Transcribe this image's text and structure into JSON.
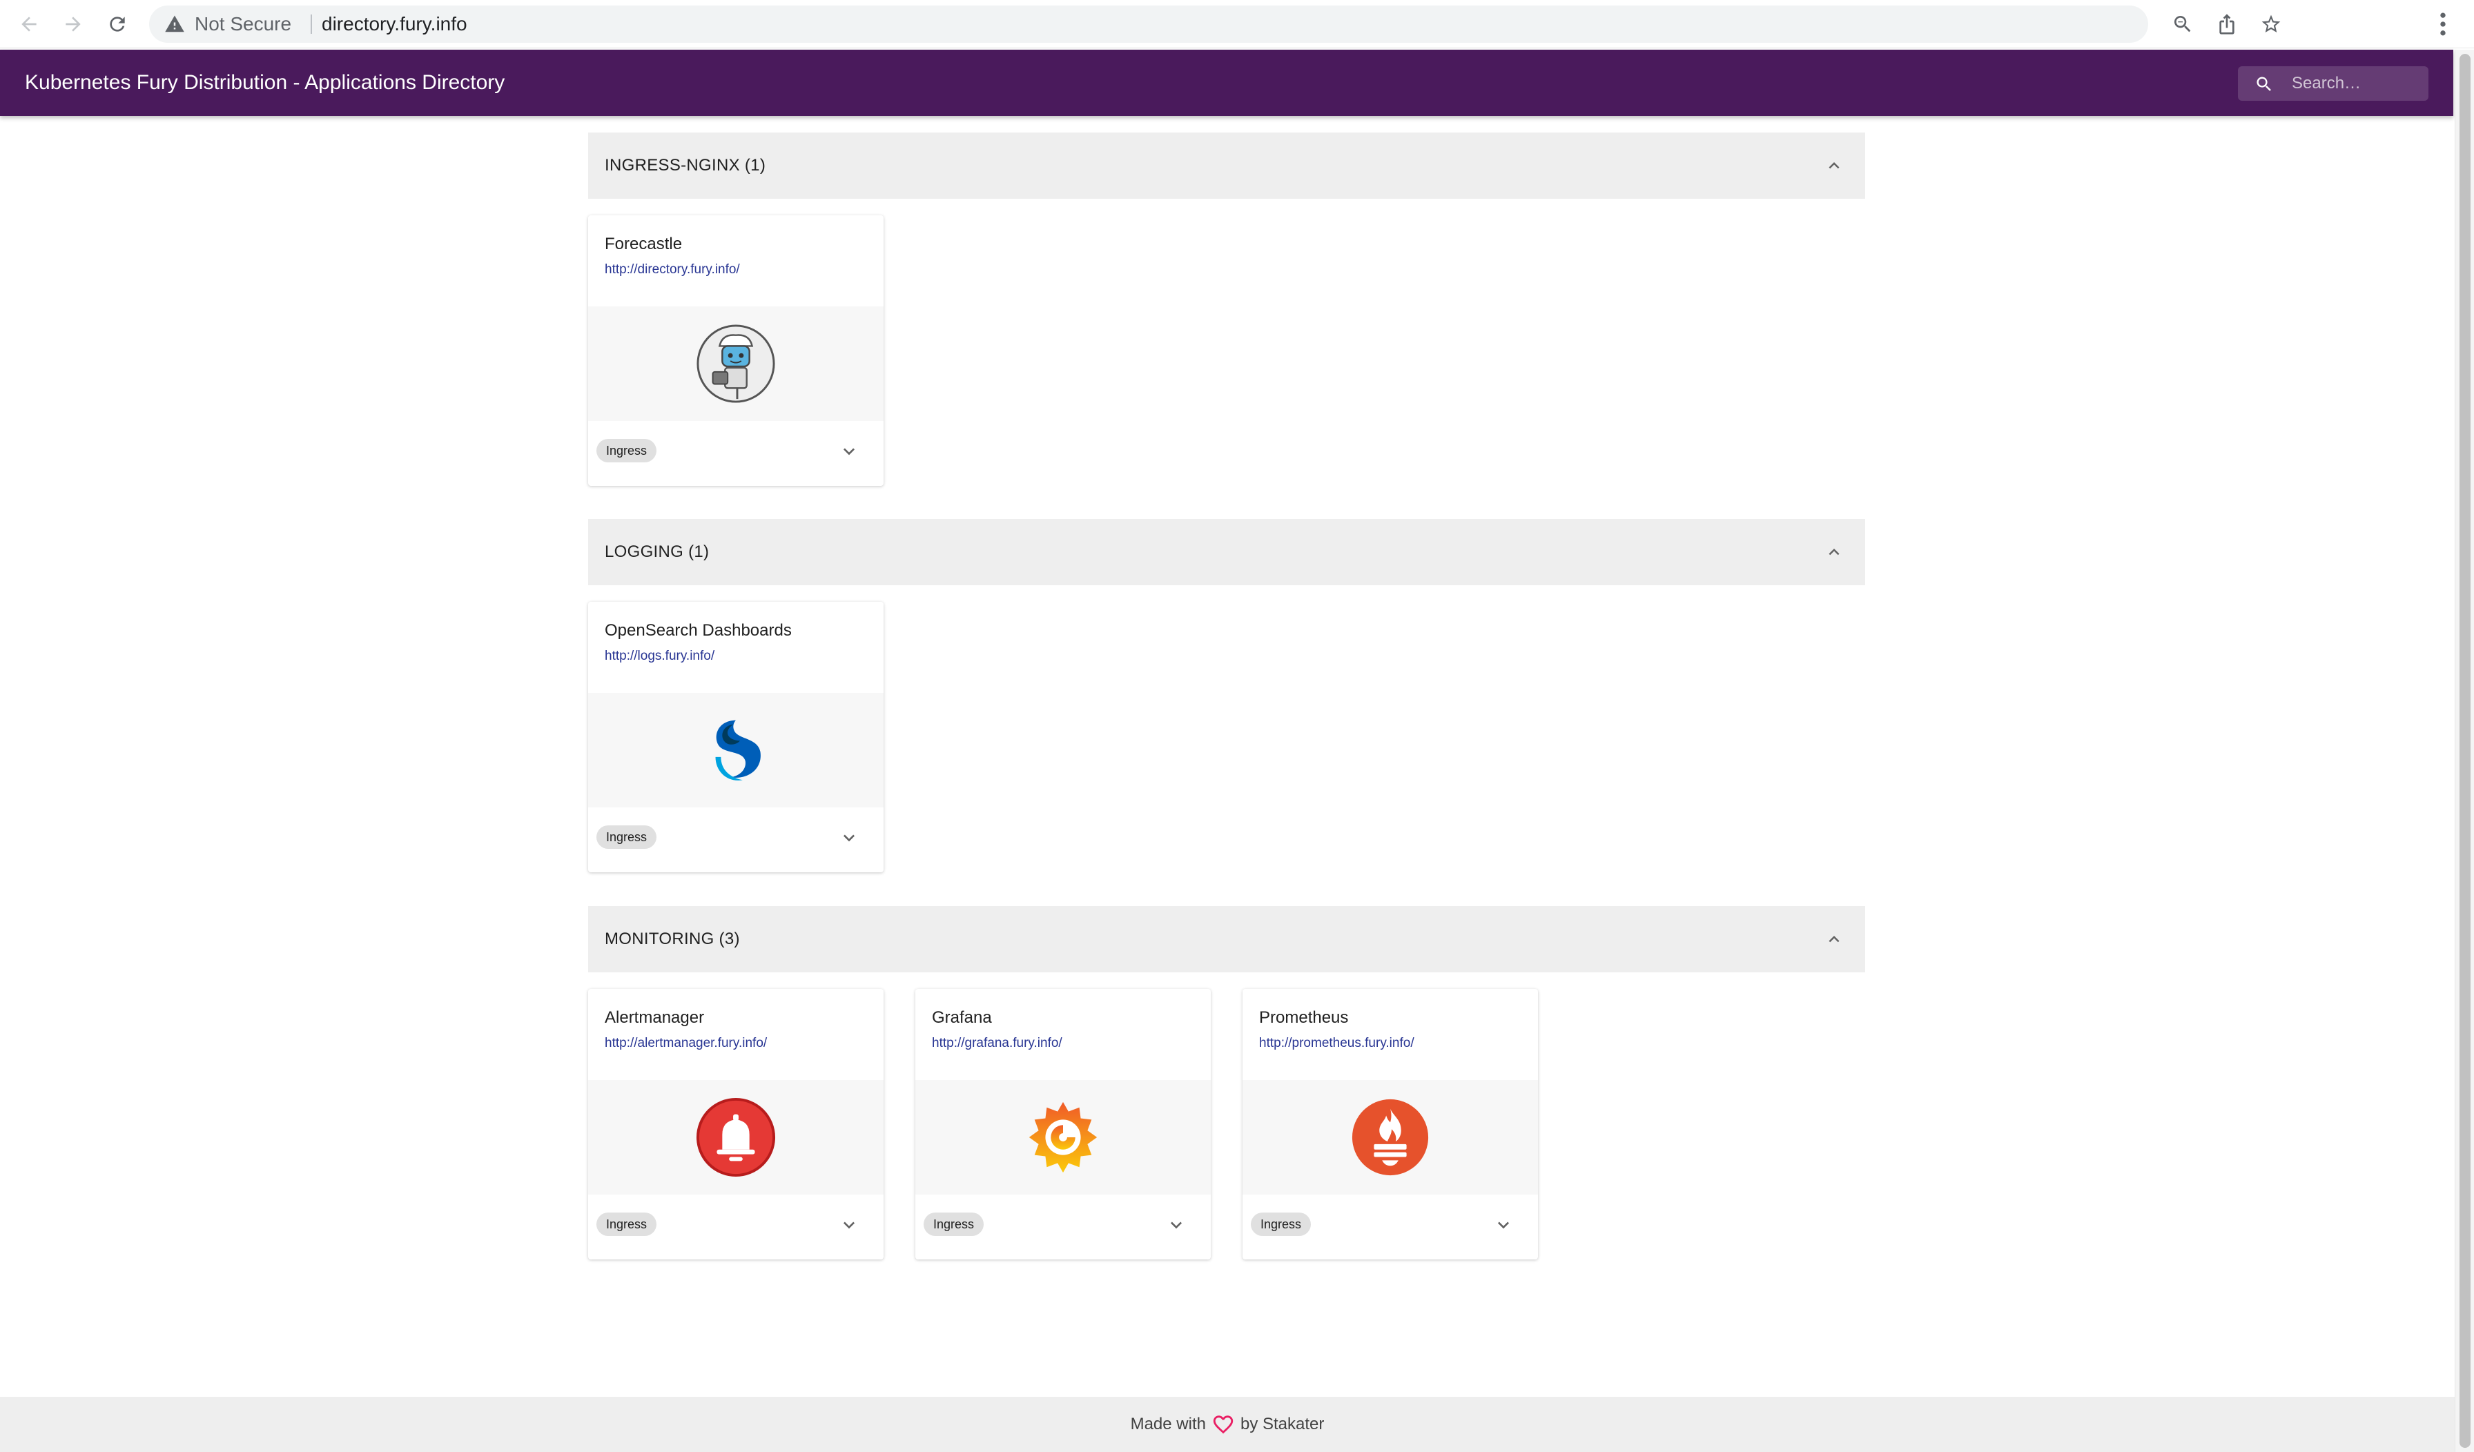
{
  "browser": {
    "security_label": "Not Secure",
    "url": "directory.fury.info"
  },
  "header": {
    "title": "Kubernetes Fury Distribution - Applications Directory",
    "search_placeholder": "Search…",
    "background_color": "#4a1a5c"
  },
  "sections": [
    {
      "title": "INGRESS-NGINX (1)",
      "apps": [
        {
          "name": "Forecastle",
          "url": "http://directory.fury.info/",
          "icon": "forecastle-logo-icon",
          "tag": "Ingress"
        }
      ]
    },
    {
      "title": "LOGGING (1)",
      "apps": [
        {
          "name": "OpenSearch Dashboards",
          "url": "http://logs.fury.info/",
          "icon": "opensearch-logo-icon",
          "tag": "Ingress"
        }
      ]
    },
    {
      "title": "MONITORING (3)",
      "apps": [
        {
          "name": "Alertmanager",
          "url": "http://alertmanager.fury.info/",
          "icon": "alertmanager-bell-icon",
          "tag": "Ingress"
        },
        {
          "name": "Grafana",
          "url": "http://grafana.fury.info/",
          "icon": "grafana-logo-icon",
          "tag": "Ingress"
        },
        {
          "name": "Prometheus",
          "url": "http://prometheus.fury.info/",
          "icon": "prometheus-logo-icon",
          "tag": "Ingress"
        }
      ]
    }
  ],
  "footer": {
    "made_with": "Made with",
    "by": "by Stakater",
    "heart_color": "#e91e63"
  }
}
